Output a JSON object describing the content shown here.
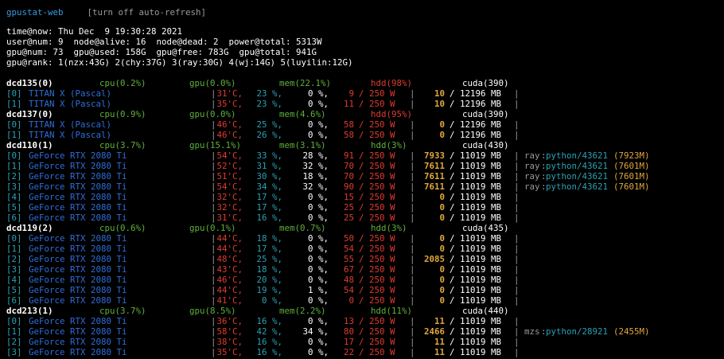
{
  "header": {
    "title": "gpustat-web",
    "refresh_link": "[turn off auto-refresh]"
  },
  "summary": {
    "time": "time@now: Thu Dec  9 19:30:28 2021",
    "nodes": "user@num: 9  node@alive: 16  node@dead: 2  power@total: 5313W",
    "gpus": "gpu@num: 73  gpu@used: 158G  gpu@free: 783G  gpu@total: 941G",
    "rank": "gpu@rank: 1(nzx:43G) 2(chy:37G) 3(ray:30G) 4(wj:14G) 5(luyilin:12G)"
  },
  "colors": {
    "background": "#000000",
    "host": "#ffffff",
    "index": "#2aa1b3",
    "gpu_name": "#2f6dd8",
    "temperature": "#e03b2e",
    "utilization": "#2aa1b3",
    "memory_used": "#e0a73a",
    "ok_stat": "#5fb03a",
    "alert_stat": "#e03b2e"
  },
  "servers": [
    {
      "name": "dcd135(0)",
      "cpu": "cpu(0.2%)",
      "gpu": "gpu(0.0%)",
      "mem": "mem(22.1%)",
      "hdd": "hdd(98%)",
      "hdd_alert": true,
      "cuda": "cuda(390)",
      "gpus": [
        {
          "idx": "[0]",
          "name": "TITAN X (Pascal)",
          "temp": "31'C,",
          "util": "23 %,",
          "mem_util": "0 %,",
          "power": "9",
          "cap": "/ 250 W",
          "mem_used": "10",
          "mem_total": "/ 12196 MB",
          "procs": []
        },
        {
          "idx": "[1]",
          "name": "TITAN X (Pascal)",
          "temp": "35'C,",
          "util": "23 %,",
          "mem_util": "0 %,",
          "power": "11",
          "cap": "/ 250 W",
          "mem_used": "10",
          "mem_total": "/ 12196 MB",
          "procs": []
        }
      ]
    },
    {
      "name": "dcd137(0)",
      "cpu": "cpu(0.9%)",
      "gpu": "gpu(0.0%)",
      "mem": "mem(4.6%)",
      "hdd": "hdd(95%)",
      "hdd_alert": true,
      "cuda": "cuda(390)",
      "gpus": [
        {
          "idx": "[0]",
          "name": "TITAN X (Pascal)",
          "temp": "46'C,",
          "util": "25 %,",
          "mem_util": "0 %,",
          "power": "58",
          "cap": "/ 250 W",
          "mem_used": "0",
          "mem_total": "/ 12196 MB",
          "procs": []
        },
        {
          "idx": "[1]",
          "name": "TITAN X (Pascal)",
          "temp": "46'C,",
          "util": "26 %,",
          "mem_util": "0 %,",
          "power": "58",
          "cap": "/ 250 W",
          "mem_used": "0",
          "mem_total": "/ 12196 MB",
          "procs": []
        }
      ]
    },
    {
      "name": "dcd110(1)",
      "cpu": "cpu(3.7%)",
      "gpu": "gpu(15.1%)",
      "mem": "mem(3.1%)",
      "hdd": "hdd(3%)",
      "hdd_alert": false,
      "cuda": "cuda(430)",
      "gpus": [
        {
          "idx": "[0]",
          "name": "GeForce RTX 2080 Ti",
          "temp": "54'C,",
          "util": "33 %,",
          "mem_util": "28 %,",
          "power": "91",
          "cap": "/ 250 W",
          "mem_used": "7933",
          "mem_total": "/ 11019 MB",
          "procs": [
            {
              "user": "ray",
              "proc": "python/43621",
              "mem": "(7923M)"
            }
          ]
        },
        {
          "idx": "[1]",
          "name": "GeForce RTX 2080 Ti",
          "temp": "52'C,",
          "util": "31 %,",
          "mem_util": "32 %,",
          "power": "70",
          "cap": "/ 250 W",
          "mem_used": "7611",
          "mem_total": "/ 11019 MB",
          "procs": [
            {
              "user": "ray",
              "proc": "python/43621",
              "mem": "(7601M)"
            }
          ]
        },
        {
          "idx": "[2]",
          "name": "GeForce RTX 2080 Ti",
          "temp": "51'C,",
          "util": "30 %,",
          "mem_util": "18 %,",
          "power": "70",
          "cap": "/ 250 W",
          "mem_used": "7611",
          "mem_total": "/ 11019 MB",
          "procs": [
            {
              "user": "ray",
              "proc": "python/43621",
              "mem": "(7601M)"
            }
          ]
        },
        {
          "idx": "[3]",
          "name": "GeForce RTX 2080 Ti",
          "temp": "54'C,",
          "util": "34 %,",
          "mem_util": "32 %,",
          "power": "90",
          "cap": "/ 250 W",
          "mem_used": "7611",
          "mem_total": "/ 11019 MB",
          "procs": [
            {
              "user": "ray",
              "proc": "python/43621",
              "mem": "(7601M)"
            }
          ]
        },
        {
          "idx": "[4]",
          "name": "GeForce RTX 2080 Ti",
          "temp": "32'C,",
          "util": "17 %,",
          "mem_util": "0 %,",
          "power": "15",
          "cap": "/ 250 W",
          "mem_used": "0",
          "mem_total": "/ 11019 MB",
          "procs": []
        },
        {
          "idx": "[5]",
          "name": "GeForce RTX 2080 Ti",
          "temp": "32'C,",
          "util": "17 %,",
          "mem_util": "0 %,",
          "power": "25",
          "cap": "/ 250 W",
          "mem_used": "0",
          "mem_total": "/ 11019 MB",
          "procs": []
        },
        {
          "idx": "[6]",
          "name": "GeForce RTX 2080 Ti",
          "temp": "31'C,",
          "util": "16 %,",
          "mem_util": "0 %,",
          "power": "25",
          "cap": "/ 250 W",
          "mem_used": "0",
          "mem_total": "/ 11019 MB",
          "procs": []
        }
      ]
    },
    {
      "name": "dcd119(2)",
      "cpu": "cpu(0.6%)",
      "gpu": "gpu(0.1%)",
      "mem": "mem(0.7%)",
      "hdd": "hdd(3%)",
      "hdd_alert": false,
      "cuda": "cuda(435)",
      "gpus": [
        {
          "idx": "[0]",
          "name": "GeForce RTX 2080 Ti",
          "temp": "44'C,",
          "util": "18 %,",
          "mem_util": "0 %,",
          "power": "50",
          "cap": "/ 250 W",
          "mem_used": "0",
          "mem_total": "/ 11019 MB",
          "procs": []
        },
        {
          "idx": "[1]",
          "name": "GeForce RTX 2080 Ti",
          "temp": "44'C,",
          "util": "17 %,",
          "mem_util": "0 %,",
          "power": "54",
          "cap": "/ 250 W",
          "mem_used": "0",
          "mem_total": "/ 11019 MB",
          "procs": []
        },
        {
          "idx": "[2]",
          "name": "GeForce RTX 2080 Ti",
          "temp": "48'C,",
          "util": "25 %,",
          "mem_util": "0 %,",
          "power": "55",
          "cap": "/ 250 W",
          "mem_used": "2085",
          "mem_total": "/ 11019 MB",
          "procs": []
        },
        {
          "idx": "[3]",
          "name": "GeForce RTX 2080 Ti",
          "temp": "43'C,",
          "util": "18 %,",
          "mem_util": "0 %,",
          "power": "67",
          "cap": "/ 250 W",
          "mem_used": "0",
          "mem_total": "/ 11019 MB",
          "procs": []
        },
        {
          "idx": "[4]",
          "name": "GeForce RTX 2080 Ti",
          "temp": "46'C,",
          "util": "20 %,",
          "mem_util": "0 %,",
          "power": "48",
          "cap": "/ 250 W",
          "mem_used": "0",
          "mem_total": "/ 11019 MB",
          "procs": []
        },
        {
          "idx": "[5]",
          "name": "GeForce RTX 2080 Ti",
          "temp": "44'C,",
          "util": "19 %,",
          "mem_util": "1 %,",
          "power": "54",
          "cap": "/ 250 W",
          "mem_used": "0",
          "mem_total": "/ 11019 MB",
          "procs": []
        },
        {
          "idx": "[6]",
          "name": "GeForce RTX 2080 Ti",
          "temp": "41'C,",
          "util": "0 %,",
          "mem_util": "0 %,",
          "power": "0",
          "cap": "/ 250 W",
          "mem_used": "0",
          "mem_total": "/ 11019 MB",
          "procs": []
        }
      ]
    },
    {
      "name": "dcd213(1)",
      "cpu": "cpu(3.7%)",
      "gpu": "gpu(8.5%)",
      "mem": "mem(2.2%)",
      "hdd": "hdd(11%)",
      "hdd_alert": false,
      "cuda": "cuda(440)",
      "gpus": [
        {
          "idx": "[0]",
          "name": "GeForce RTX 2080 Ti",
          "temp": "36'C,",
          "util": "16 %,",
          "mem_util": "0 %,",
          "power": "13",
          "cap": "/ 250 W",
          "mem_used": "11",
          "mem_total": "/ 11019 MB",
          "procs": []
        },
        {
          "idx": "[1]",
          "name": "GeForce RTX 2080 Ti",
          "temp": "58'C,",
          "util": "42 %,",
          "mem_util": "34 %,",
          "power": "80",
          "cap": "/ 250 W",
          "mem_used": "2466",
          "mem_total": "/ 11019 MB",
          "procs": [
            {
              "user": "mzs",
              "proc": "python/28921",
              "mem": "(2455M)"
            }
          ]
        },
        {
          "idx": "[2]",
          "name": "GeForce RTX 2080 Ti",
          "temp": "38'C,",
          "util": "16 %,",
          "mem_util": "0 %,",
          "power": "17",
          "cap": "/ 250 W",
          "mem_used": "11",
          "mem_total": "/ 11019 MB",
          "procs": []
        },
        {
          "idx": "[3]",
          "name": "GeForce RTX 2080 Ti",
          "temp": "35'C,",
          "util": "16 %,",
          "mem_util": "0 %,",
          "power": "22",
          "cap": "/ 250 W",
          "mem_used": "11",
          "mem_total": "/ 11019 MB",
          "procs": []
        }
      ]
    }
  ]
}
